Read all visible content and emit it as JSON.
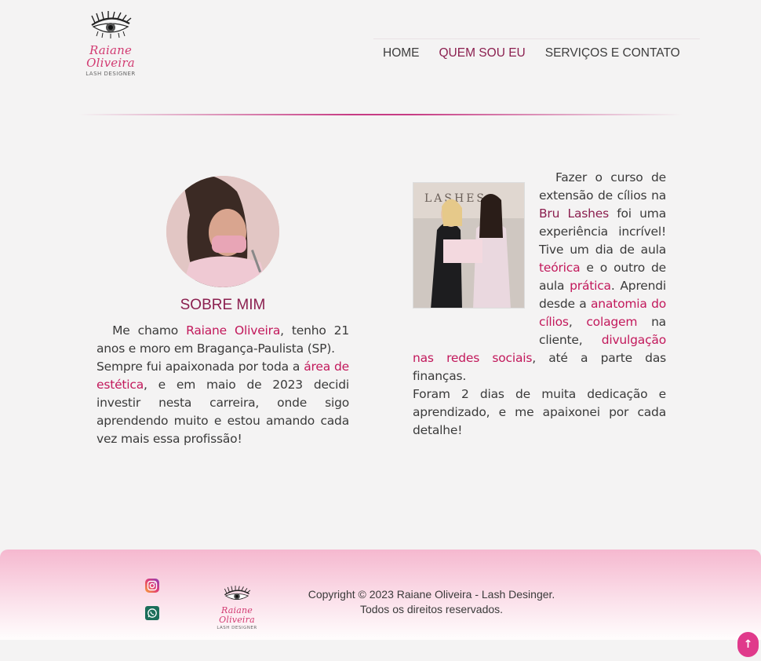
{
  "header": {
    "logo": {
      "name": "Raiane Oliveira",
      "subtitle": "LASH DESIGNER"
    },
    "nav": [
      {
        "label": "HOME"
      },
      {
        "label": "QUEM SOU EU",
        "active": true
      },
      {
        "label": "SERVIÇOS E CONTATO"
      }
    ]
  },
  "about": {
    "title": "SOBRE MIM",
    "p1_a": "Me chamo ",
    "p1_name": "Raiane Oliveira",
    "p1_b": ", tenho 21 anos e moro em Bragança-Paulista (SP).",
    "p2_a": "Sempre fui apaixonada por toda a ",
    "p2_hl": "área de estética",
    "p2_b": ", e em maio de 2023 decidi investir nesta carreira, onde sigo aprendendo muito e estou amando cada vez mais essa profissão!"
  },
  "course": {
    "t1": "Fazer o curso de extensão de cílios na ",
    "t1_strong": "Bru Lashes",
    "t2": " foi uma experiência incrível! Tive um dia de aula ",
    "t2_hl": "teórica",
    "t3": " e o outro de aula ",
    "t3_hl": "prática",
    "t4": ". Aprendi desde a ",
    "t4_hl": "anatomia do cílios",
    "t5": ", ",
    "t5_hl": "colagem",
    "t6": " na cliente, ",
    "t6_hl": "divulgação nas redes sociais",
    "t7": ", até a parte das finanças.",
    "p2": "Foram 2 dias de muita dedicação e aprendizado, e me apaixonei por cada detalhe!",
    "photo_sign": "LASHES"
  },
  "footer": {
    "copyright_line1": "Copyright © 2023 Raiane Oliveira - Lash Desinger.",
    "copyright_line2": "Todos os direitos reservados.",
    "icons": [
      "instagram-icon",
      "whatsapp-icon"
    ]
  },
  "back_to_top": {
    "glyph": "↑"
  },
  "colors": {
    "accent": "#c2185b",
    "nav_active": "#8b1f4f",
    "divider": "#c73c84",
    "footer_top": "#f5b8cf"
  }
}
